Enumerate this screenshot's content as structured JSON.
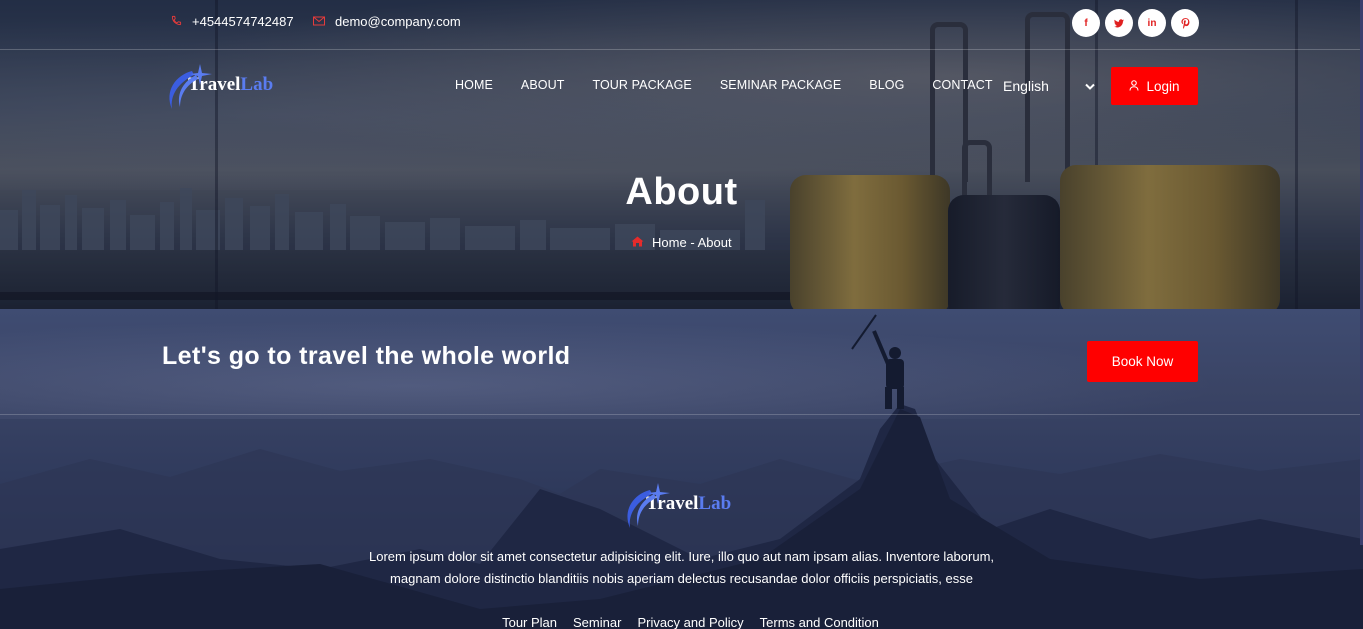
{
  "topbar": {
    "phone": "+4544574742487",
    "email": "demo@company.com",
    "social": [
      "f",
      "t",
      "in",
      "p"
    ]
  },
  "brand": {
    "part1": "Travel",
    "part2": "Lab"
  },
  "nav": {
    "items": [
      "HOME",
      "ABOUT",
      "TOUR PACKAGE",
      "SEMINAR PACKAGE",
      "BLOG",
      "CONTACT"
    ],
    "language": "English",
    "login_label": "Login"
  },
  "hero": {
    "title": "About",
    "breadcrumb_home": "Home",
    "breadcrumb_sep": " - ",
    "breadcrumb_current": "About"
  },
  "cta": {
    "headline": "Let's go to travel the whole world",
    "button": "Book Now"
  },
  "footer": {
    "description_line1": "Lorem ipsum dolor sit amet consectetur adipisicing elit. Iure, illo quo aut nam ipsam alias. Inventore laborum,",
    "description_line2": "magnam dolore distinctio blanditiis nobis aperiam delectus recusandae dolor officiis perspiciatis, esse",
    "links": [
      "Tour Plan",
      "Seminar",
      "Privacy and Policy",
      "Terms and Condition"
    ]
  },
  "colors": {
    "accent": "#ff0000",
    "brand_blue": "#5a7cf0",
    "dark_navy": "#1d2540"
  },
  "icons": {
    "phone": "phone-icon",
    "email": "envelope-icon",
    "user": "user-icon",
    "home": "home-icon",
    "chevron": "chevron-down-icon"
  }
}
